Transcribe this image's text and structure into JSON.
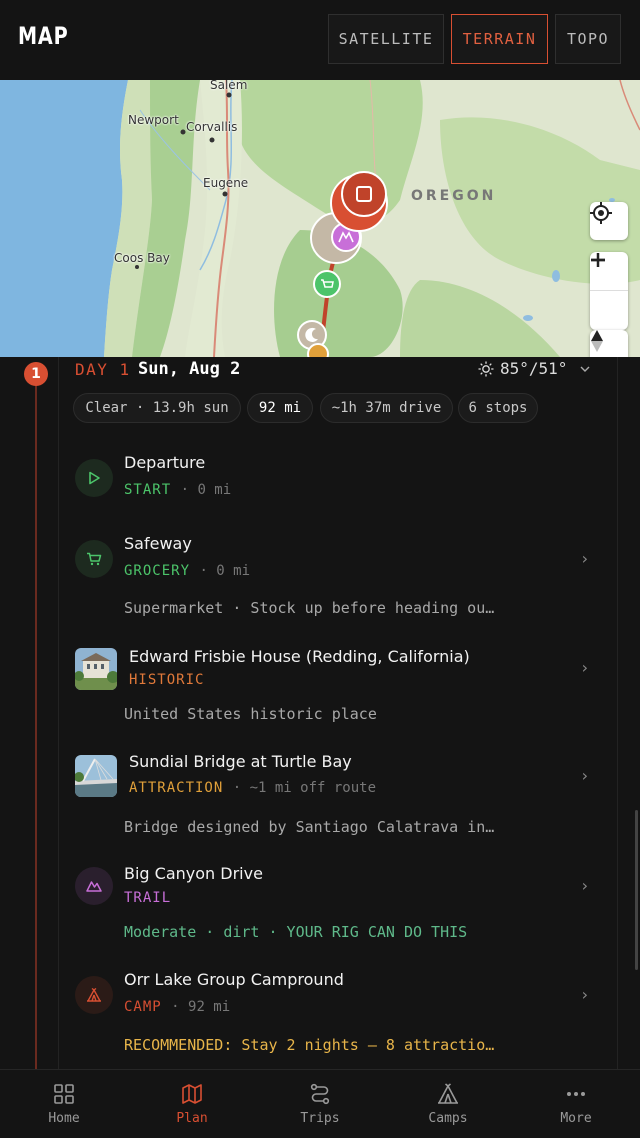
{
  "header": {
    "title": "MAP",
    "map_modes": [
      {
        "label": "SATELLITE",
        "active": false
      },
      {
        "label": "TERRAIN",
        "active": true
      },
      {
        "label": "TOPO",
        "active": false
      }
    ]
  },
  "map": {
    "labels": {
      "salem": "Salem",
      "newport": "Newport",
      "corvallis": "Corvallis",
      "eugene": "Eugene",
      "coos_bay": "Coos Bay",
      "oregon": "OREGON"
    },
    "controls": [
      "locate",
      "zoom-in",
      "zoom-out",
      "compass"
    ]
  },
  "day": {
    "number": "1",
    "label": "DAY 1",
    "date": "Sun, Aug 2",
    "weather": "85°/51°",
    "chips": {
      "conditions": "Clear · 13.9h sun",
      "distance": "92 mi",
      "drive": "~1h 37m drive",
      "stops": "6 stops"
    }
  },
  "stops": [
    {
      "name": "Departure",
      "category": "START",
      "meta": "· 0 mi",
      "desc": ""
    },
    {
      "name": "Safeway",
      "category": "GROCERY",
      "meta": "· 0 mi",
      "desc": "Supermarket · Stock up before heading ou…"
    },
    {
      "name": "Edward Frisbie House (Redding, California)",
      "category": "HISTORIC",
      "meta": "",
      "desc": "United States historic place"
    },
    {
      "name": "Sundial Bridge at Turtle Bay",
      "category": "ATTRACTION",
      "meta": "· ~1 mi off route",
      "desc": "Bridge designed by Santiago Calatrava in…"
    },
    {
      "name": "Big Canyon Drive",
      "category": "TRAIL",
      "meta": "",
      "desc": "Moderate · dirt · YOUR RIG CAN DO THIS"
    },
    {
      "name": "Orr Lake Group Campround",
      "category": "CAMP",
      "meta": "· 92 mi",
      "desc": "RECOMMENDED: Stay 2 nights — 8 attractio…"
    }
  ],
  "colors": {
    "accent": "#d84f32",
    "start": "#4cc46a",
    "grocery": "#4cc46a",
    "historic": "#e0793a",
    "attraction": "#e0a03a",
    "trail": "#c86fd8",
    "camp": "#d84f32",
    "recommended": "#e8b54a",
    "rig_ok": "#5fb98a"
  },
  "nav": [
    {
      "label": "Home",
      "icon": "grid-icon",
      "active": false
    },
    {
      "label": "Plan",
      "icon": "map-icon",
      "active": true
    },
    {
      "label": "Trips",
      "icon": "route-icon",
      "active": false
    },
    {
      "label": "Camps",
      "icon": "tent-icon",
      "active": false
    },
    {
      "label": "More",
      "icon": "more-icon",
      "active": false
    }
  ]
}
